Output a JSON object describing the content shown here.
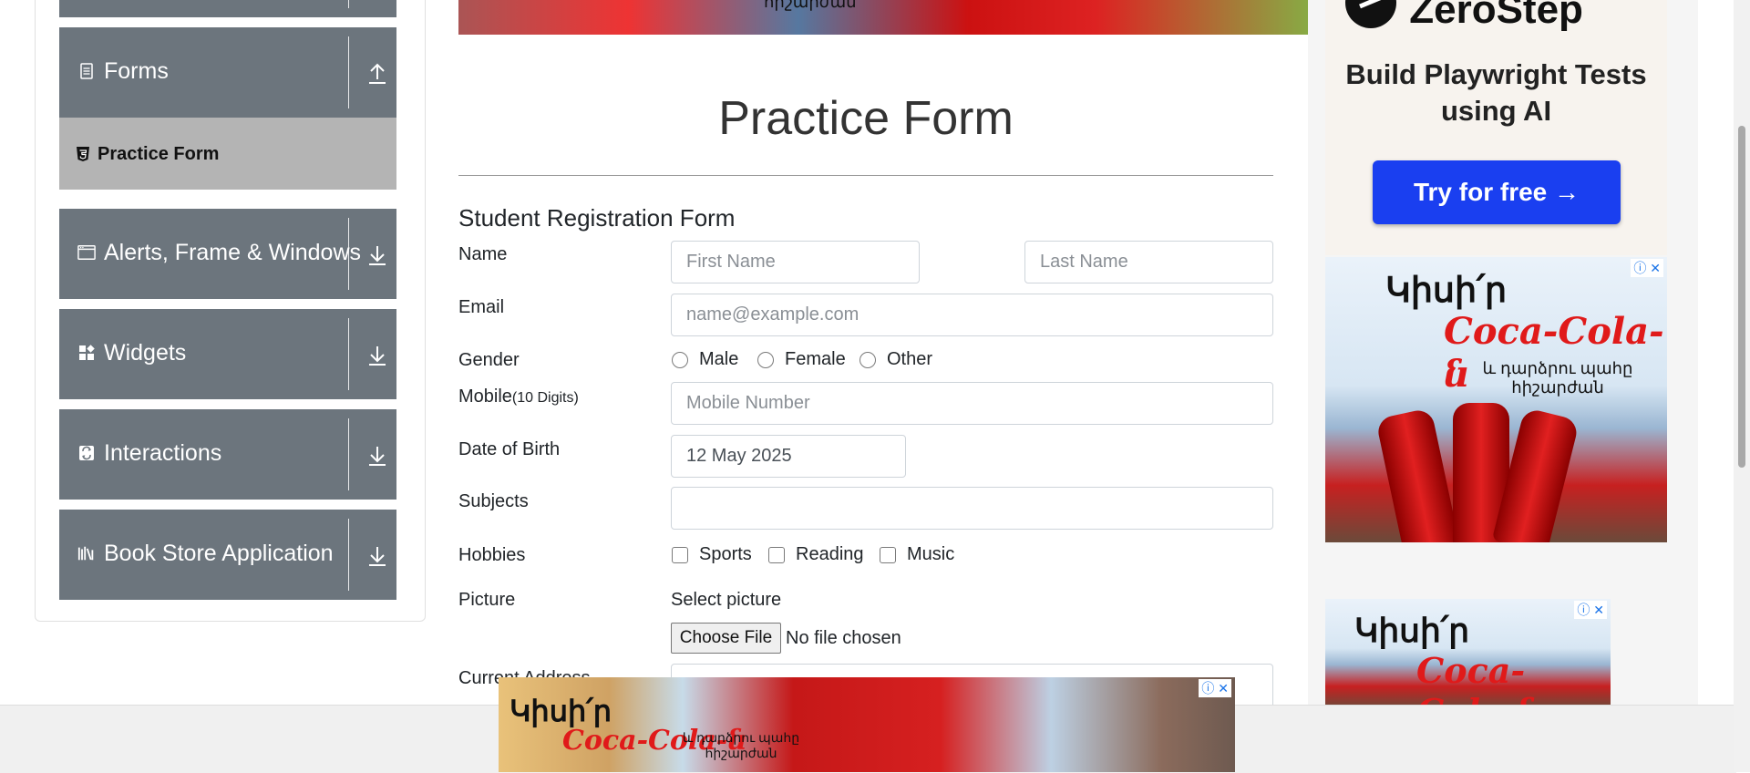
{
  "sidebar": {
    "groups": [
      {
        "label": "Forms",
        "icon": "document-icon",
        "state": "expanded"
      },
      {
        "label": "Alerts, Frame & Windows",
        "icon": "window-icon"
      },
      {
        "label": "Widgets",
        "icon": "widgets-icon"
      },
      {
        "label": "Interactions",
        "icon": "interactions-icon"
      },
      {
        "label": "Book Store Application",
        "icon": "books-icon"
      }
    ],
    "active_item": "Practice Form"
  },
  "main": {
    "title": "Practice Form",
    "form_heading": "Student Registration Form",
    "fields": {
      "name_label": "Name",
      "first_name_placeholder": "First Name",
      "last_name_placeholder": "Last Name",
      "email_label": "Email",
      "email_placeholder": "name@example.com",
      "gender_label": "Gender",
      "gender_options": [
        "Male",
        "Female",
        "Other"
      ],
      "mobile_label": "Mobile",
      "mobile_hint": "(10 Digits)",
      "mobile_placeholder": "Mobile Number",
      "dob_label": "Date of Birth",
      "dob_value": "12 May 2025",
      "subjects_label": "Subjects",
      "hobbies_label": "Hobbies",
      "hobby_options": [
        "Sports",
        "Reading",
        "Music"
      ],
      "picture_label": "Picture",
      "picture_caption": "Select picture",
      "file_button": "Choose File",
      "file_status": "No file chosen",
      "address_label": "Current Address"
    }
  },
  "ads": {
    "zerostep_logo": "ZeroStep",
    "zerostep_title": "Build Playwright Tests using AI",
    "zerostep_cta": "Try for free →",
    "coke_line1": "Կիսի՛ր",
    "coke_brand": "Coca-Cola-ն",
    "coke_line2": "և դարձրու պահը հիշարժան",
    "banner_partial": "հիշարժան",
    "brand_color": "#e01a1a",
    "cta_color": "#1a3ff0"
  }
}
